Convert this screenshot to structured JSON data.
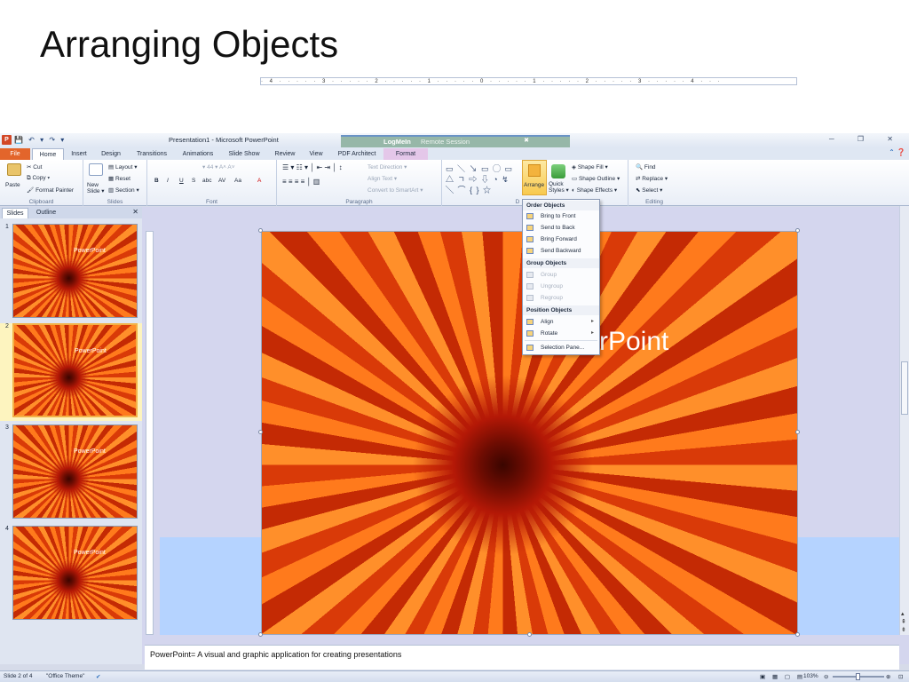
{
  "slide_title": "Arranging Objects",
  "app": {
    "logo": "P",
    "qat": "💾 ↶ ▾ ↷ ▾",
    "window_title": "Presentation1 - Microsoft PowerPoint",
    "logmein_brand": "LogMeIn",
    "logmein_text": "Remote Session",
    "window_controls": "─ ❐ ✕"
  },
  "tabs": [
    "File",
    "Home",
    "Insert",
    "Design",
    "Transitions",
    "Animations",
    "Slide Show",
    "Review",
    "View",
    "PDF Architect",
    "Format"
  ],
  "ribbon": {
    "clipboard": {
      "paste": "Paste",
      "cut": "Cut",
      "copy": "Copy ▾",
      "format_painter": "Format Painter",
      "label": "Clipboard"
    },
    "slides": {
      "new_slide": "New Slide ▾",
      "layout": "Layout ▾",
      "reset": "Reset",
      "section": "Section ▾",
      "label": "Slides"
    },
    "font": {
      "size": "44",
      "bold": "B",
      "italic": "I",
      "underline": "U",
      "strike": "S",
      "shadow": "abc",
      "spacing": "AV",
      "case": "Aa",
      "color": "A",
      "label": "Font"
    },
    "paragraph": {
      "text_direction": "Text Direction ▾",
      "align_text": "Align Text ▾",
      "smartart": "Convert to SmartArt ▾",
      "label": "Paragraph"
    },
    "drawing": {
      "shapes": "▭ ＼ ↘ ▭ ◯ ▭ △ ㄱ ⇨ ⇩ ◔ ↯ ╲ ⌒ { } ☆",
      "arrange": "Arrange",
      "quick_styles": "Quick Styles ▾",
      "shape_fill": "Shape Fill ▾",
      "shape_outline": "Shape Outline ▾",
      "shape_effects": "Shape Effects ▾",
      "label": "D"
    },
    "editing": {
      "find": "Find",
      "replace": "Replace ▾",
      "select": "Select ▾",
      "label": "Editing"
    }
  },
  "panel": {
    "tabs": [
      "Slides",
      "Outline"
    ],
    "close": "✕",
    "thumbnails": [
      {
        "num": "1",
        "text": "PowerPoint"
      },
      {
        "num": "2",
        "text": "PowerPoint"
      },
      {
        "num": "3",
        "text": "PowerPoint"
      },
      {
        "num": "4",
        "text": "PowerPoint"
      }
    ]
  },
  "ruler": "· 4 · · · · · 3 · · · · · 2 · · · · · 1 · · · · · 0 · · · · · 1 · · · · · 2 · · · · · 3 · · · · · 4 · · ·",
  "slide_text": "rPoint",
  "arrange_menu": {
    "order_header": "Order Objects",
    "order_items": [
      "Bring to Front",
      "Send to Back",
      "Bring Forward",
      "Send Backward"
    ],
    "group_header": "Group Objects",
    "group_items": [
      "Group",
      "Ungroup",
      "Regroup"
    ],
    "position_header": "Position Objects",
    "position_items": [
      "Align",
      "Rotate"
    ],
    "selection_pane": "Selection Pane..."
  },
  "notes": "PowerPoint= A visual and graphic application for creating presentations",
  "status": {
    "slide": "Slide 2 of 4",
    "theme": "\"Office Theme\"",
    "zoom": "103%"
  }
}
